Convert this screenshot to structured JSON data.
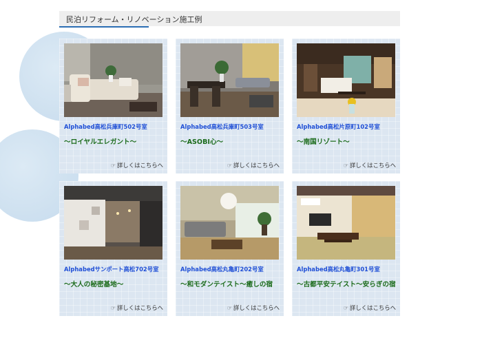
{
  "section": {
    "title": "民泊リフォーム・リノベーション施工例"
  },
  "more_label": "詳しくはこちらへ",
  "more_icon": "pointing-hand-icon",
  "cards": [
    {
      "name": "Alphabed高松兵庫町502号室",
      "catch": "～ロイヤルエレガント～",
      "photo": "living-room-sofa-photo"
    },
    {
      "name": "Alphabed高松兵庫町503号室",
      "catch": "～ASOBI心～",
      "photo": "dining-room-photo"
    },
    {
      "name": "Alphabed高松片原町102号室",
      "catch": "～南国リゾート～",
      "photo": "resort-bedroom-photo"
    },
    {
      "name": "Alphabedサンポート高松702号室",
      "catch": "～大人の秘密基地～",
      "photo": "loft-room-photo"
    },
    {
      "name": "Alphabed高松丸亀町202号室",
      "catch": "～和モダンテイスト～癒しの宿",
      "photo": "japanese-modern-room-photo"
    },
    {
      "name": "Alphabed高松丸亀町301号室",
      "catch": "～古都平安テイスト～安らぎの宿",
      "photo": "tatami-room-photo"
    }
  ],
  "colors": {
    "name_text": "#1f4fd6",
    "catch_text": "#1b6b1b",
    "card_bg": "#dce6f1",
    "header_bg": "#eeeeee",
    "header_accent": "#2a6db3"
  }
}
